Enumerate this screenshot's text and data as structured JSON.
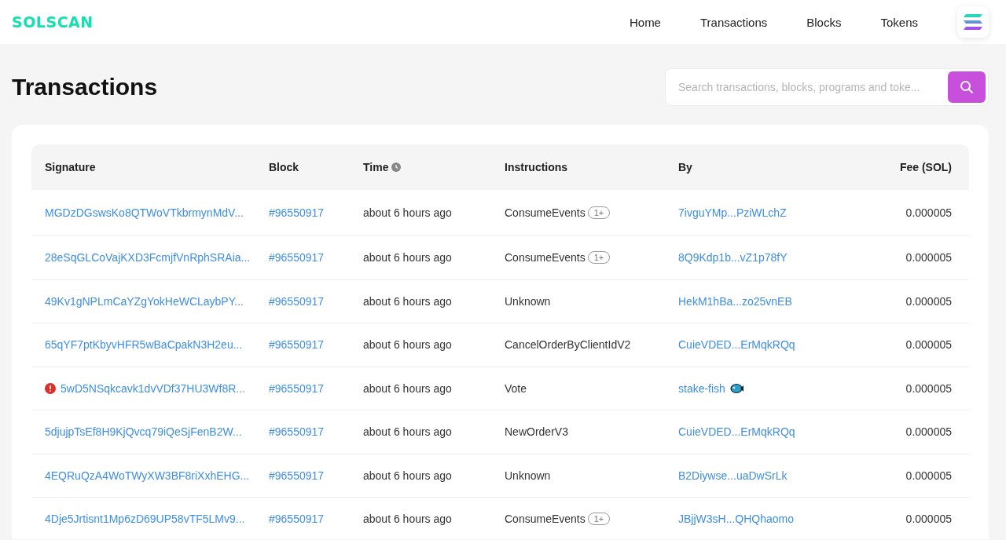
{
  "header": {
    "logo": "SOLSCAN",
    "nav": [
      {
        "label": "Home"
      },
      {
        "label": "Transactions"
      },
      {
        "label": "Blocks"
      },
      {
        "label": "Tokens"
      }
    ]
  },
  "page": {
    "title": "Transactions",
    "search": {
      "placeholder": "Search transactions, blocks, programs and toke..."
    }
  },
  "table": {
    "columns": [
      "Signature",
      "Block",
      "Time",
      "Instructions",
      "By",
      "Fee (SOL)"
    ],
    "rows": [
      {
        "signature": "MGDzDGswsKo8QTWoVTkbrmynMdV...",
        "failed": false,
        "block": "#96550917",
        "time": "about 6 hours ago",
        "instruction": "ConsumeEvents",
        "extra": "1+",
        "by": "7ivguYMp...PziWLchZ",
        "fee": "0.000005"
      },
      {
        "signature": "28eSqGLCoVajKXD3FcmjfVnRphSRAia...",
        "failed": false,
        "block": "#96550917",
        "time": "about 6 hours ago",
        "instruction": "ConsumeEvents",
        "extra": "1+",
        "by": "8Q9Kdp1b...vZ1p78fY",
        "fee": "0.000005"
      },
      {
        "signature": "49Kv1gNPLmCaYZgYokHeWCLaybPY...",
        "failed": false,
        "block": "#96550917",
        "time": "about 6 hours ago",
        "instruction": "Unknown",
        "by": "HekM1hBa...zo25vnEB",
        "fee": "0.000005"
      },
      {
        "signature": "65qYF7ptKbyvHFR5wBaCpakN3H2eu...",
        "failed": false,
        "block": "#96550917",
        "time": "about 6 hours ago",
        "instruction": "CancelOrderByClientIdV2",
        "by": "CuieVDED...ErMqkRQq",
        "fee": "0.000005"
      },
      {
        "signature": "5wD5NSqkcavk1dvVDf37HU3Wf8R...",
        "failed": true,
        "block": "#96550917",
        "time": "about 6 hours ago",
        "instruction": "Vote",
        "by": "stake-fish",
        "by_icon": true,
        "fee": "0.000005"
      },
      {
        "signature": "5djujpTsEf8H9KjQvcq79iQeSjFenB2W...",
        "failed": false,
        "block": "#96550917",
        "time": "about 6 hours ago",
        "instruction": "NewOrderV3",
        "by": "CuieVDED...ErMqkRQq",
        "fee": "0.000005"
      },
      {
        "signature": "4EQRuQzA4WoTWyXW3BF8riXxhEHG...",
        "failed": false,
        "block": "#96550917",
        "time": "about 6 hours ago",
        "instruction": "Unknown",
        "by": "B2Diywse...uaDwSrLk",
        "fee": "0.000005"
      },
      {
        "signature": "4Dje5Jrtisnt1Mp6zD69UP58vTF5LMv9...",
        "failed": false,
        "block": "#96550917",
        "time": "about 6 hours ago",
        "instruction": "ConsumeEvents",
        "extra": "1+",
        "by": "JBjjW3sH...QHQhaomo",
        "fee": "0.000005"
      }
    ]
  }
}
